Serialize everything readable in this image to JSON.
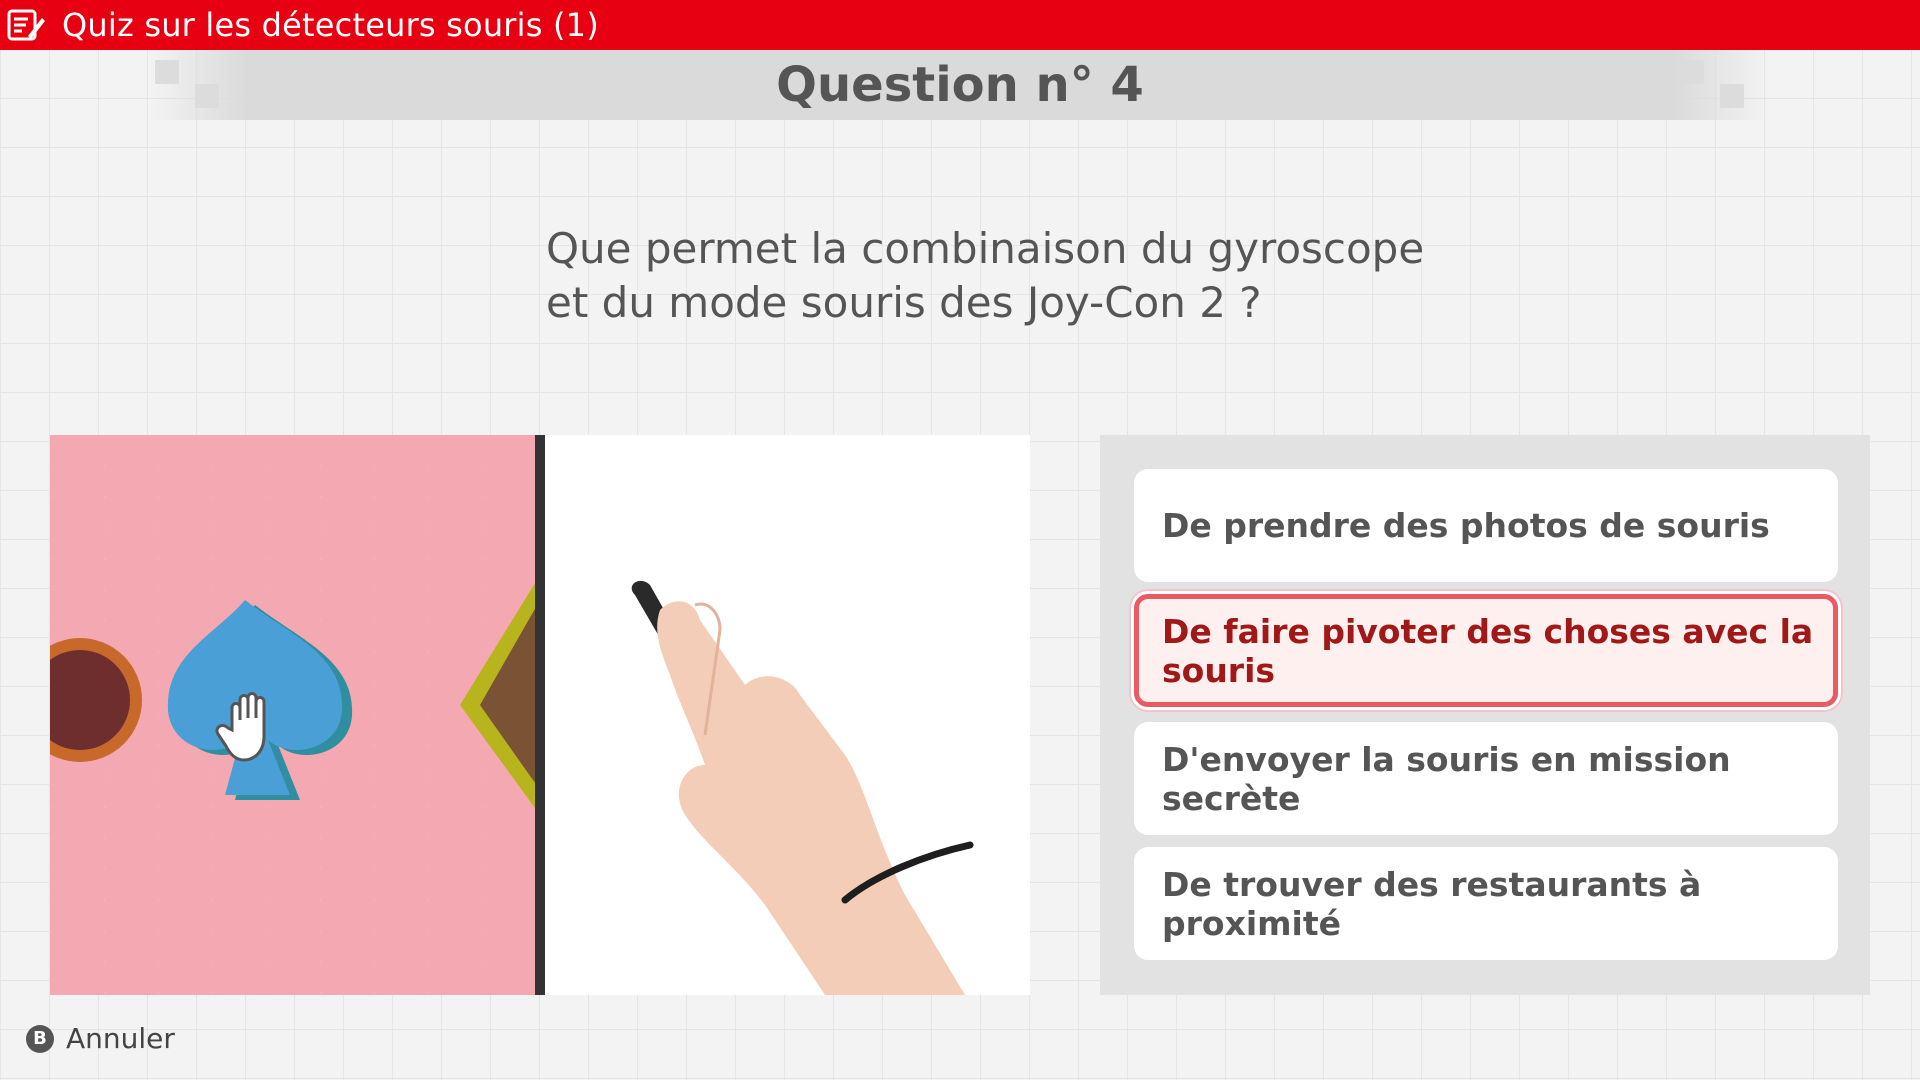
{
  "header": {
    "title": "Quiz sur les détecteurs souris (1)",
    "icon": "quiz-pencil-icon"
  },
  "question": {
    "heading": "Question n° 4",
    "line1": "Que permet la combinaison du gyroscope",
    "line2": "et du mode souris des Joy-Con 2 ?"
  },
  "answers": [
    {
      "label": "De prendre des photos de souris",
      "selected": false
    },
    {
      "label": "De faire pivoter des choses avec la souris",
      "selected": true
    },
    {
      "label": "D'envoyer la souris en mission secrète",
      "selected": false
    },
    {
      "label": "De trouver des restaurants à proximité",
      "selected": false
    }
  ],
  "footer": {
    "button_glyph": "B",
    "cancel_label": "Annuler"
  },
  "colors": {
    "accent": "#e60012",
    "selected_border": "#ea5a64",
    "selected_text": "#a01818"
  }
}
